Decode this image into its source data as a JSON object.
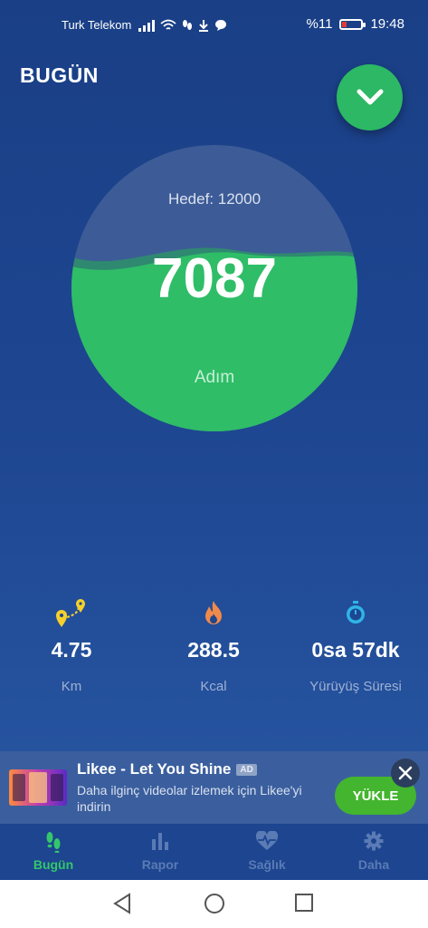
{
  "status_bar": {
    "carrier": "Turk Telekom",
    "battery": "%11",
    "time": "19:48"
  },
  "header": {
    "title": "BUGÜN"
  },
  "progress": {
    "goal_label": "Hedef: 12000",
    "steps": "7087",
    "unit": "Adım",
    "fill_fraction": 0.59
  },
  "stats": [
    {
      "value": "4.75",
      "label": "Km",
      "icon": "map-pin-route-icon"
    },
    {
      "value": "288.5",
      "label": "Kcal",
      "icon": "flame-icon"
    },
    {
      "value": "0sa 57dk",
      "label": "Yürüyüş Süresi",
      "icon": "stopwatch-icon"
    }
  ],
  "ad": {
    "title": "Likee - Let You Shine",
    "tag": "AD",
    "description": "Daha ilginç videolar izlemek için Likee'yi indirin",
    "button": "YÜKLE"
  },
  "tabs": [
    {
      "label": "Bugün",
      "icon": "footsteps-icon",
      "active": true
    },
    {
      "label": "Rapor",
      "icon": "bar-chart-icon",
      "active": false
    },
    {
      "label": "Sağlık",
      "icon": "heart-pulse-icon",
      "active": false
    },
    {
      "label": "Daha",
      "icon": "gear-icon",
      "active": false
    }
  ],
  "colors": {
    "accent": "#2cb865",
    "background": "#1e4691",
    "tab_active": "#34c76a"
  }
}
